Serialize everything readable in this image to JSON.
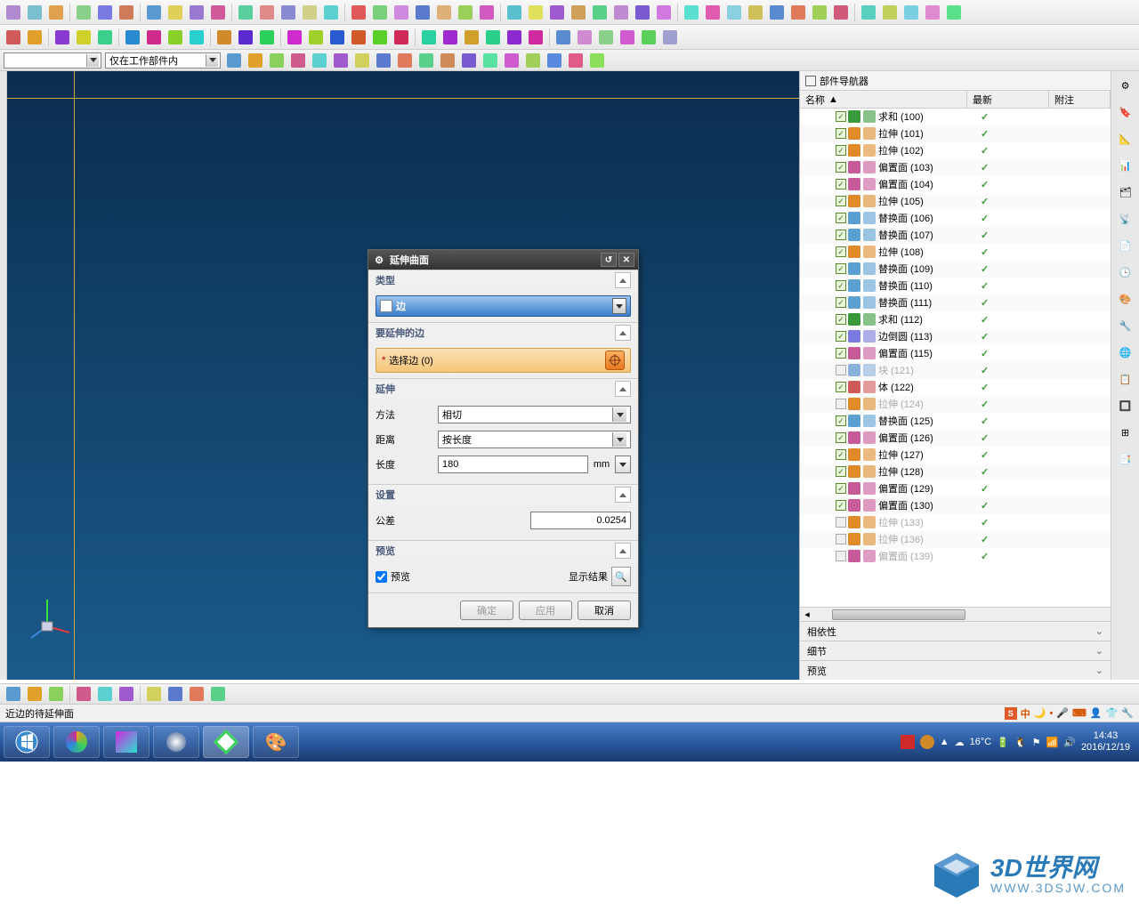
{
  "filter": {
    "scope": "仅在工作部件内"
  },
  "dialog": {
    "title": "延伸曲面",
    "sec_type": "类型",
    "type_value": "边",
    "sec_edges": "要延伸的边",
    "select_edge": "选择边 (0)",
    "sec_extend": "延伸",
    "method_label": "方法",
    "method_value": "相切",
    "distance_label": "距离",
    "distance_value": "按长度",
    "length_label": "长度",
    "length_value": "180",
    "length_unit": "mm",
    "sec_settings": "设置",
    "tolerance_label": "公差",
    "tolerance_value": "0.0254",
    "sec_preview": "预览",
    "preview_chk": "预览",
    "show_result": "显示结果",
    "ok": "确定",
    "apply": "应用",
    "cancel": "取消"
  },
  "nav": {
    "title": "部件导航器",
    "col_name": "名称",
    "col_latest": "最新",
    "col_note": "附注",
    "items": [
      {
        "label": "求和 (100)",
        "c": "#3a9a3a",
        "en": true
      },
      {
        "label": "拉伸 (101)",
        "c": "#e08a2a",
        "en": true
      },
      {
        "label": "拉伸 (102)",
        "c": "#e08a2a",
        "en": true
      },
      {
        "label": "偏置面 (103)",
        "c": "#c85a9a",
        "en": true
      },
      {
        "label": "偏置面 (104)",
        "c": "#c85a9a",
        "en": true
      },
      {
        "label": "拉伸 (105)",
        "c": "#e08a2a",
        "en": true
      },
      {
        "label": "替换面 (106)",
        "c": "#5aa0d0",
        "en": true
      },
      {
        "label": "替换面 (107)",
        "c": "#5aa0d0",
        "en": true
      },
      {
        "label": "拉伸 (108)",
        "c": "#e08a2a",
        "en": true
      },
      {
        "label": "替换面 (109)",
        "c": "#5aa0d0",
        "en": true
      },
      {
        "label": "替换面 (110)",
        "c": "#5aa0d0",
        "en": true
      },
      {
        "label": "替换面 (111)",
        "c": "#5aa0d0",
        "en": true
      },
      {
        "label": "求和 (112)",
        "c": "#3a9a3a",
        "en": true
      },
      {
        "label": "边倒圆 (113)",
        "c": "#7a7ae0",
        "en": true
      },
      {
        "label": "偏置面 (115)",
        "c": "#c85a9a",
        "en": true
      },
      {
        "label": "块 (121)",
        "c": "#88b0d8",
        "en": false
      },
      {
        "label": "体 (122)",
        "c": "#d05a5a",
        "en": true
      },
      {
        "label": "拉伸 (124)",
        "c": "#e08a2a",
        "en": false
      },
      {
        "label": "替换面 (125)",
        "c": "#5aa0d0",
        "en": true
      },
      {
        "label": "偏置面 (126)",
        "c": "#c85a9a",
        "en": true
      },
      {
        "label": "拉伸 (127)",
        "c": "#e08a2a",
        "en": true
      },
      {
        "label": "拉伸 (128)",
        "c": "#e08a2a",
        "en": true
      },
      {
        "label": "偏置面 (129)",
        "c": "#c85a9a",
        "en": true
      },
      {
        "label": "偏置面 (130)",
        "c": "#c85a9a",
        "en": true
      },
      {
        "label": "拉伸 (133)",
        "c": "#e08a2a",
        "en": false
      },
      {
        "label": "拉伸 (136)",
        "c": "#e08a2a",
        "en": false
      },
      {
        "label": "偏置面 (139)",
        "c": "#c85a9a",
        "en": false
      }
    ],
    "sub_depend": "相依性",
    "sub_detail": "细节",
    "sub_preview": "预览"
  },
  "status": {
    "hint": "近边的待延伸面",
    "ime": "中"
  },
  "tray": {
    "temp": "16°C",
    "time": "14:43",
    "date": "2016/12/19"
  },
  "watermark": {
    "title": "3D世界网",
    "url": "WWW.3DSJW.COM"
  },
  "toolbar_colors_1": [
    "#b08ad0",
    "#7abed0",
    "#e0a050",
    "#8ad08a",
    "#7a7ae0",
    "#d07a5a",
    "#5a9ad0",
    "#e0d05a",
    "#9a7ad0",
    "#d05a9a",
    "#5ad0a0",
    "#e08a8a",
    "#8a8ad0",
    "#d0d08a",
    "#5ad0d0",
    "#e05a5a",
    "#7ad07a",
    "#d08ae0",
    "#5a7ad0",
    "#e0b07a",
    "#9ad05a",
    "#d05ac0",
    "#5ac0d0",
    "#e0e05a",
    "#a05ad0",
    "#d0a05a",
    "#5ad08a",
    "#c08ad0",
    "#7a5ad0",
    "#d07ae0",
    "#5ae0d0",
    "#e05ab0",
    "#8ad0e0",
    "#d0c05a",
    "#5a8ad0",
    "#e07a5a",
    "#a0d05a",
    "#d05a7a",
    "#5ad0c0",
    "#c0d05a",
    "#7ad0e0",
    "#e08ad0",
    "#5ae08a"
  ],
  "toolbar_colors_2": [
    "#d05a5a",
    "#e0a02a",
    "#8a3ad0",
    "#d0d02a",
    "#3ad08a",
    "#2a8ad0",
    "#d02a8a",
    "#8ad02a",
    "#2ad0d0",
    "#d08a2a",
    "#5a2ad0",
    "#2ad05a",
    "#d02ad0",
    "#a0d02a",
    "#2a5ad0",
    "#d05a2a",
    "#5ad02a",
    "#d02a5a",
    "#2ad0a0",
    "#a02ad0",
    "#d0a02a",
    "#2ad08a",
    "#8a2ad0",
    "#d02aa0",
    "#5a8ad0",
    "#d08ad0",
    "#8ad08a",
    "#d05ad0",
    "#5ad05a",
    "#a0a0d0"
  ]
}
